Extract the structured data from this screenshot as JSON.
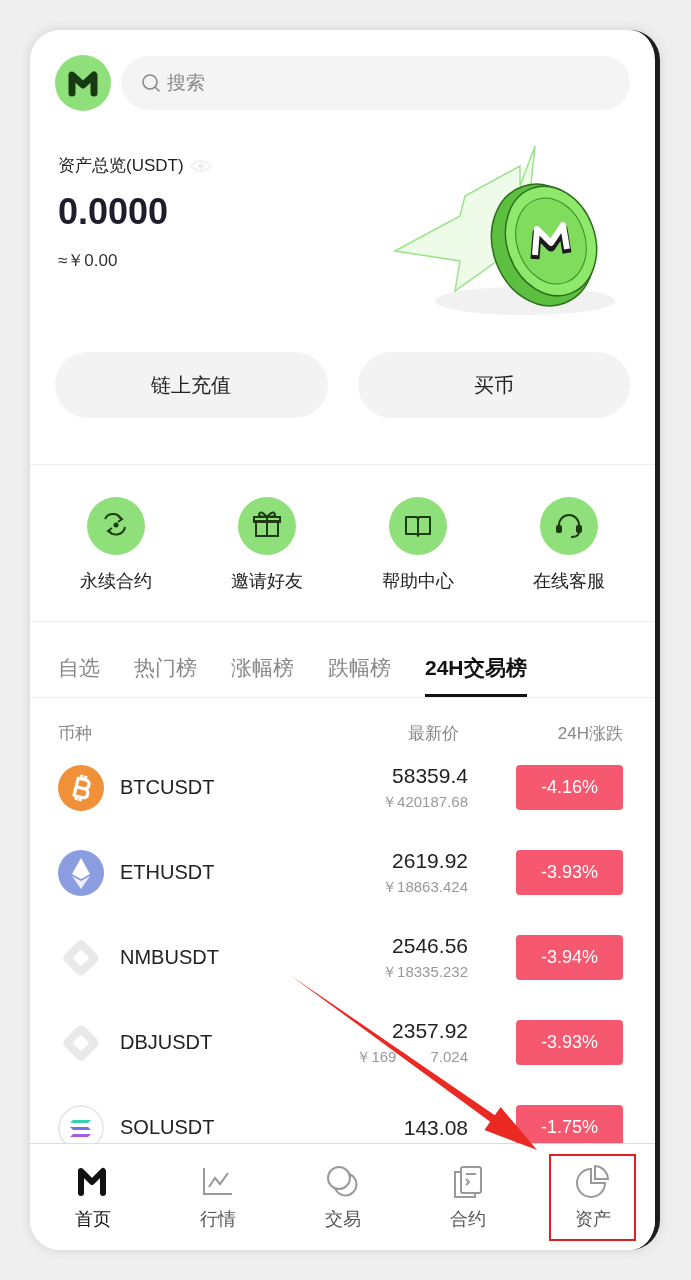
{
  "header": {
    "search": {
      "placeholder": "搜索"
    }
  },
  "overview": {
    "title": "资产总览(USDT)",
    "amount": "0.0000",
    "approx": "≈￥0.00"
  },
  "actions": [
    "链上充值",
    "买币"
  ],
  "shortcuts": [
    {
      "kind": "rotate",
      "label": "永续合约"
    },
    {
      "kind": "gift",
      "label": "邀请好友"
    },
    {
      "kind": "book",
      "label": "帮助中心"
    },
    {
      "kind": "headset",
      "label": "在线客服"
    }
  ],
  "tabs": [
    {
      "label": "自选",
      "selected": false
    },
    {
      "label": "热门榜",
      "selected": false
    },
    {
      "label": "涨幅榜",
      "selected": false
    },
    {
      "label": "跌幅榜",
      "selected": false
    },
    {
      "label": "24H交易榜",
      "selected": true
    }
  ],
  "columns": [
    "币种",
    "最新价",
    "24H涨跌"
  ],
  "rows": [
    {
      "kind": "btc",
      "symbol": "BTCUSDT",
      "price": "58359.4",
      "price_cny": "￥420187.68",
      "change": "-4.16%"
    },
    {
      "kind": "eth",
      "symbol": "ETHUSDT",
      "price": "2619.92",
      "price_cny": "￥18863.424",
      "change": "-3.93%"
    },
    {
      "kind": "generic",
      "symbol": "NMBUSDT",
      "price": "2546.56",
      "price_cny": "￥18335.232",
      "change": "-3.94%"
    },
    {
      "kind": "generic",
      "symbol": "DBJUSDT",
      "price": "2357.92",
      "price_cny": "￥169",
      "price_cny_tail": "7.024",
      "change": "-3.93%"
    },
    {
      "kind": "sol",
      "symbol": "SOLUSDT",
      "price": "143.08",
      "change": "-1.75%"
    }
  ],
  "nav": [
    {
      "kind": "logo",
      "label": "首页",
      "selected": true,
      "highlighted": false
    },
    {
      "kind": "chart",
      "label": "行情",
      "selected": false,
      "highlighted": false
    },
    {
      "kind": "circles",
      "label": "交易",
      "selected": false,
      "highlighted": false
    },
    {
      "kind": "document",
      "label": "合约",
      "selected": false,
      "highlighted": false
    },
    {
      "kind": "pie",
      "label": "资产",
      "selected": false,
      "highlighted": true
    }
  ]
}
